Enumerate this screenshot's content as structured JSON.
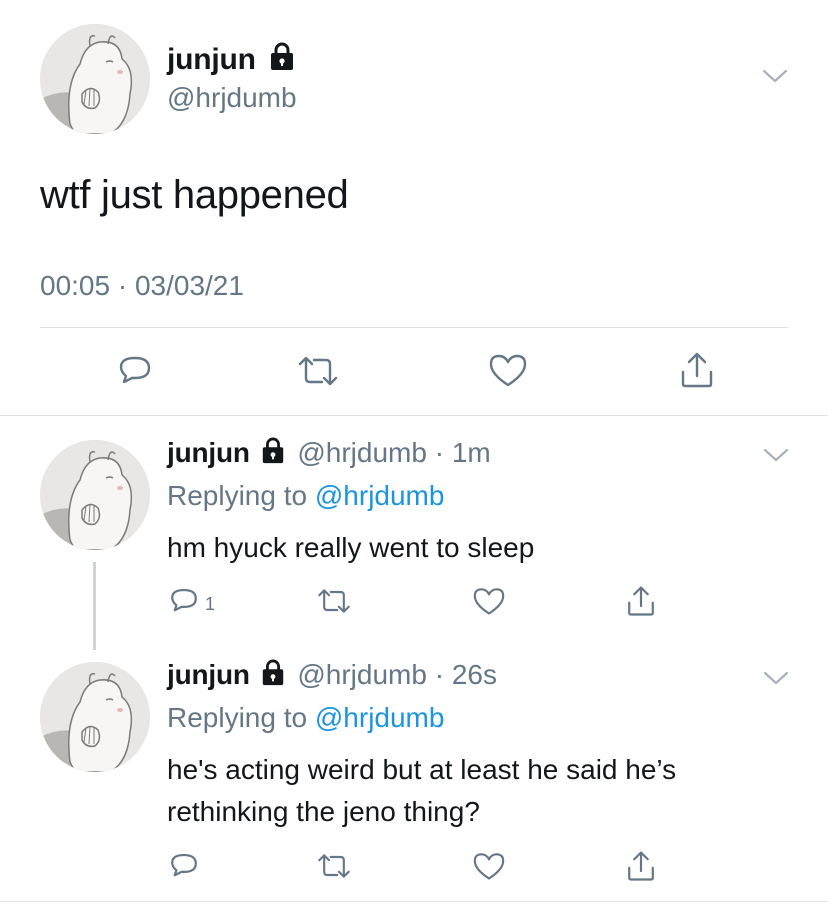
{
  "main_tweet": {
    "name": "junjun",
    "handle": "@hrjdumb",
    "text": "wtf just happened",
    "timestamp": "00:05 · 03/03/21",
    "icons": [
      "lock-icon",
      "chevron-down-icon",
      "reply-icon",
      "retweet-icon",
      "like-icon",
      "share-icon"
    ]
  },
  "replies": [
    {
      "name": "junjun",
      "handle": "@hrjdumb",
      "time": "· 1m",
      "replying_prefix": "Replying to ",
      "replying_handle": "@hrjdumb",
      "text_lines": [
        "hm hyuck really went to sleep"
      ],
      "reply_count": "1"
    },
    {
      "name": "junjun",
      "handle": "@hrjdumb",
      "time": "· 26s",
      "replying_prefix": "Replying to ",
      "replying_handle": "@hrjdumb",
      "text_lines": [
        "he's acting weird but at least he said he’s",
        "rethinking the jeno thing?"
      ],
      "reply_count": ""
    }
  ],
  "colors": {
    "text": "#14171a",
    "secondary": "#657786",
    "link": "#1b95e0",
    "divider": "#dfe3e6"
  }
}
